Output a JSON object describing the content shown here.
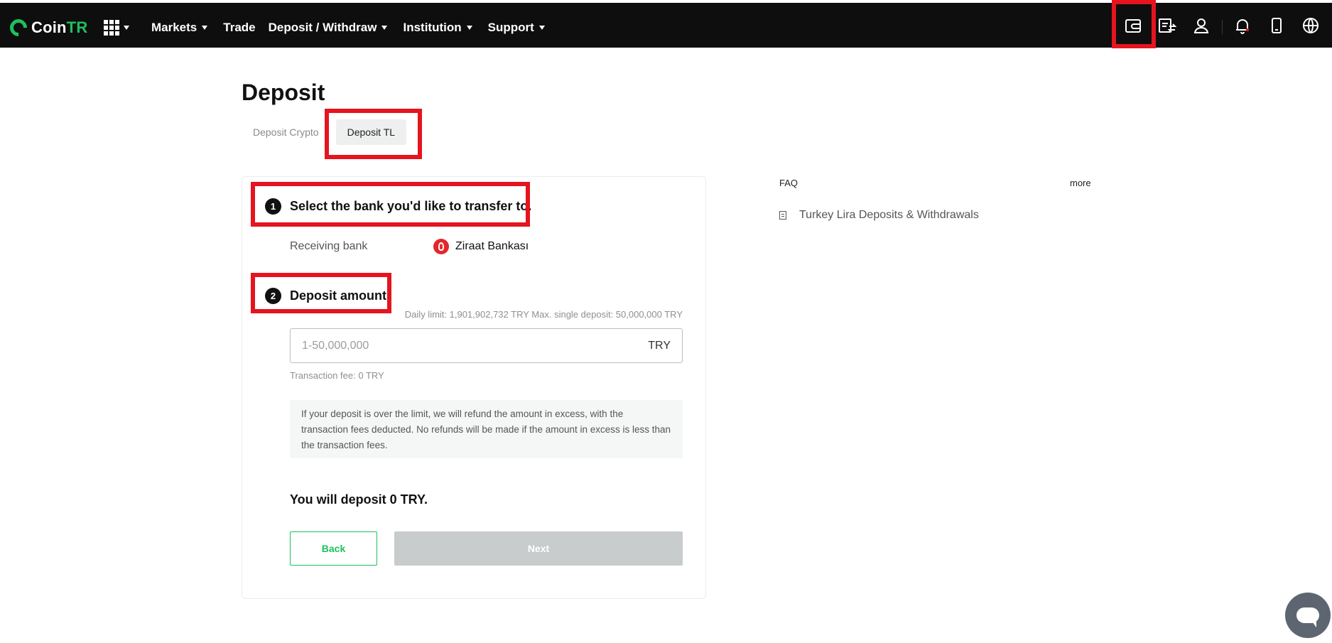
{
  "header": {
    "logo": {
      "prefix": "Coin",
      "suffix": "TR"
    },
    "nav": [
      {
        "label": "Markets",
        "dropdown": true
      },
      {
        "label": "Trade",
        "dropdown": false
      },
      {
        "label": "Deposit / Withdraw",
        "dropdown": true
      },
      {
        "label": "Institution",
        "dropdown": true
      },
      {
        "label": "Support",
        "dropdown": true
      }
    ],
    "icons": [
      "wallet-icon",
      "orders-icon",
      "user-icon",
      "bell-icon",
      "mobile-icon",
      "globe-icon"
    ]
  },
  "page": {
    "title": "Deposit",
    "tabs": [
      {
        "label": "Deposit Crypto",
        "active": false
      },
      {
        "label": "Deposit TL",
        "active": true
      }
    ]
  },
  "steps": {
    "step1": {
      "number": "1",
      "title": "Select the bank you'd like to transfer to."
    },
    "step2": {
      "number": "2",
      "title": "Deposit amount"
    }
  },
  "bank": {
    "label": "Receiving bank",
    "name": "Ziraat Bankası"
  },
  "amount": {
    "limits": "Daily limit: 1,901,902,732 TRY Max. single deposit: 50,000,000 TRY",
    "placeholder": "1-50,000,000",
    "value": "",
    "unit": "TRY",
    "fee": "Transaction fee: 0 TRY",
    "note": "If your deposit is over the limit, we will refund the amount in excess, with the transaction fees deducted. No refunds will be made if the amount in excess is less than the transaction fees."
  },
  "summary": "You will deposit 0 TRY.",
  "buttons": {
    "back": "Back",
    "next": "Next"
  },
  "faq": {
    "title": "FAQ",
    "more": "more",
    "items": [
      "Turkey Lira Deposits & Withdrawals"
    ]
  },
  "colors": {
    "brand": "#1ec05d",
    "highlight": "#e5141e",
    "topbar": "#0e0e0e",
    "disabled": "#c8cccc"
  }
}
